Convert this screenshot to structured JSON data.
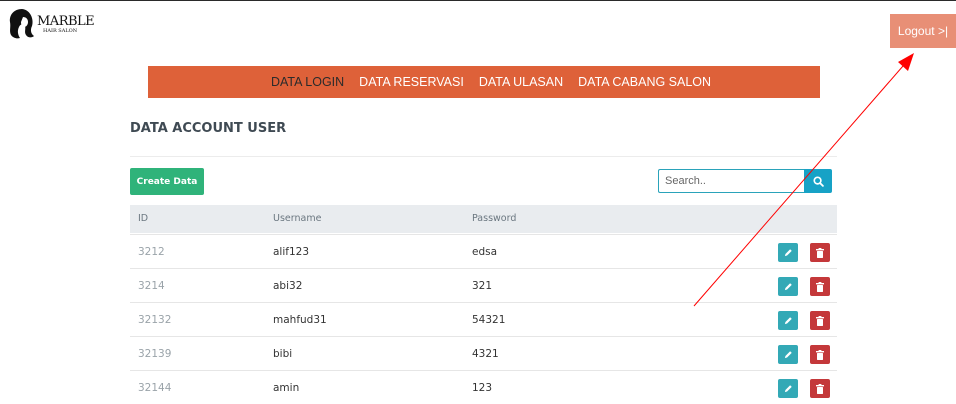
{
  "brand": {
    "name": "MARBLE",
    "tagline": "HAIR SALON"
  },
  "header": {
    "logout_label": "Logout >|"
  },
  "nav": {
    "items": [
      {
        "label": "DATA LOGIN",
        "active": true
      },
      {
        "label": "DATA RESERVASI",
        "active": false
      },
      {
        "label": "DATA ULASAN",
        "active": false
      },
      {
        "label": "DATA CABANG SALON",
        "active": false
      }
    ]
  },
  "page": {
    "title": "DATA ACCOUNT USER"
  },
  "toolbar": {
    "create_label": "Create Data",
    "search_placeholder": "Search.."
  },
  "table": {
    "columns": [
      "ID",
      "Username",
      "Password"
    ],
    "rows": [
      {
        "id": "3212",
        "username": "alif123",
        "password": "edsa"
      },
      {
        "id": "3214",
        "username": "abi32",
        "password": "321"
      },
      {
        "id": "32132",
        "username": "mahfud31",
        "password": "54321"
      },
      {
        "id": "32139",
        "username": "bibi",
        "password": "4321"
      },
      {
        "id": "32144",
        "username": "amin",
        "password": "123"
      }
    ]
  },
  "icons": {
    "edit": "pencil-icon",
    "delete": "trash-icon",
    "search": "search-icon"
  },
  "colors": {
    "nav_bg": "#de6139",
    "logout_bg": "#e88f76",
    "create_bg": "#2fb37a",
    "search_btn": "#17a2c6",
    "edit_btn": "#33a9b6",
    "delete_btn": "#c4383a",
    "annotation_arrow": "#ff0000"
  }
}
